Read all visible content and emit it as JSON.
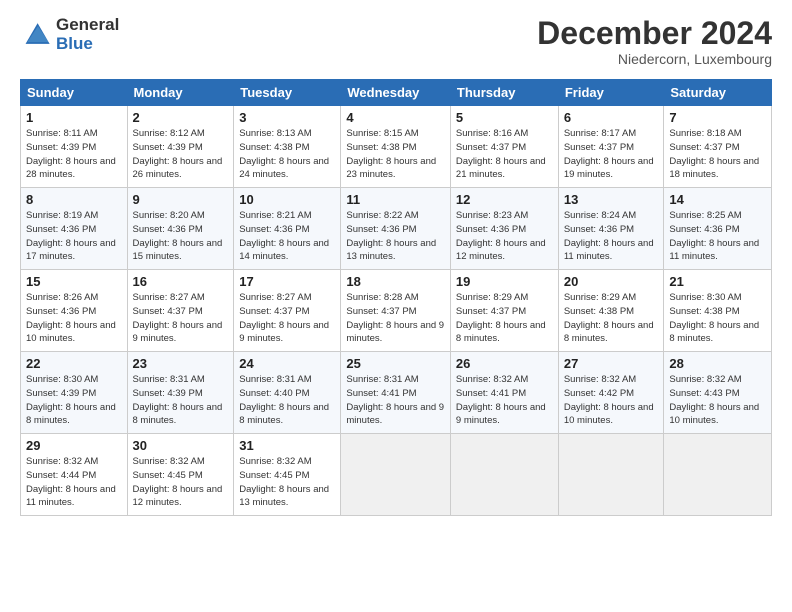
{
  "header": {
    "logo_general": "General",
    "logo_blue": "Blue",
    "month_title": "December 2024",
    "location": "Niedercorn, Luxembourg"
  },
  "weekdays": [
    "Sunday",
    "Monday",
    "Tuesday",
    "Wednesday",
    "Thursday",
    "Friday",
    "Saturday"
  ],
  "weeks": [
    [
      {
        "day": "1",
        "sunrise": "8:11 AM",
        "sunset": "4:39 PM",
        "daylight": "8 hours and 28 minutes."
      },
      {
        "day": "2",
        "sunrise": "8:12 AM",
        "sunset": "4:39 PM",
        "daylight": "8 hours and 26 minutes."
      },
      {
        "day": "3",
        "sunrise": "8:13 AM",
        "sunset": "4:38 PM",
        "daylight": "8 hours and 24 minutes."
      },
      {
        "day": "4",
        "sunrise": "8:15 AM",
        "sunset": "4:38 PM",
        "daylight": "8 hours and 23 minutes."
      },
      {
        "day": "5",
        "sunrise": "8:16 AM",
        "sunset": "4:37 PM",
        "daylight": "8 hours and 21 minutes."
      },
      {
        "day": "6",
        "sunrise": "8:17 AM",
        "sunset": "4:37 PM",
        "daylight": "8 hours and 19 minutes."
      },
      {
        "day": "7",
        "sunrise": "8:18 AM",
        "sunset": "4:37 PM",
        "daylight": "8 hours and 18 minutes."
      }
    ],
    [
      {
        "day": "8",
        "sunrise": "8:19 AM",
        "sunset": "4:36 PM",
        "daylight": "8 hours and 17 minutes."
      },
      {
        "day": "9",
        "sunrise": "8:20 AM",
        "sunset": "4:36 PM",
        "daylight": "8 hours and 15 minutes."
      },
      {
        "day": "10",
        "sunrise": "8:21 AM",
        "sunset": "4:36 PM",
        "daylight": "8 hours and 14 minutes."
      },
      {
        "day": "11",
        "sunrise": "8:22 AM",
        "sunset": "4:36 PM",
        "daylight": "8 hours and 13 minutes."
      },
      {
        "day": "12",
        "sunrise": "8:23 AM",
        "sunset": "4:36 PM",
        "daylight": "8 hours and 12 minutes."
      },
      {
        "day": "13",
        "sunrise": "8:24 AM",
        "sunset": "4:36 PM",
        "daylight": "8 hours and 11 minutes."
      },
      {
        "day": "14",
        "sunrise": "8:25 AM",
        "sunset": "4:36 PM",
        "daylight": "8 hours and 11 minutes."
      }
    ],
    [
      {
        "day": "15",
        "sunrise": "8:26 AM",
        "sunset": "4:36 PM",
        "daylight": "8 hours and 10 minutes."
      },
      {
        "day": "16",
        "sunrise": "8:27 AM",
        "sunset": "4:37 PM",
        "daylight": "8 hours and 9 minutes."
      },
      {
        "day": "17",
        "sunrise": "8:27 AM",
        "sunset": "4:37 PM",
        "daylight": "8 hours and 9 minutes."
      },
      {
        "day": "18",
        "sunrise": "8:28 AM",
        "sunset": "4:37 PM",
        "daylight": "8 hours and 9 minutes."
      },
      {
        "day": "19",
        "sunrise": "8:29 AM",
        "sunset": "4:37 PM",
        "daylight": "8 hours and 8 minutes."
      },
      {
        "day": "20",
        "sunrise": "8:29 AM",
        "sunset": "4:38 PM",
        "daylight": "8 hours and 8 minutes."
      },
      {
        "day": "21",
        "sunrise": "8:30 AM",
        "sunset": "4:38 PM",
        "daylight": "8 hours and 8 minutes."
      }
    ],
    [
      {
        "day": "22",
        "sunrise": "8:30 AM",
        "sunset": "4:39 PM",
        "daylight": "8 hours and 8 minutes."
      },
      {
        "day": "23",
        "sunrise": "8:31 AM",
        "sunset": "4:39 PM",
        "daylight": "8 hours and 8 minutes."
      },
      {
        "day": "24",
        "sunrise": "8:31 AM",
        "sunset": "4:40 PM",
        "daylight": "8 hours and 8 minutes."
      },
      {
        "day": "25",
        "sunrise": "8:31 AM",
        "sunset": "4:41 PM",
        "daylight": "8 hours and 9 minutes."
      },
      {
        "day": "26",
        "sunrise": "8:32 AM",
        "sunset": "4:41 PM",
        "daylight": "8 hours and 9 minutes."
      },
      {
        "day": "27",
        "sunrise": "8:32 AM",
        "sunset": "4:42 PM",
        "daylight": "8 hours and 10 minutes."
      },
      {
        "day": "28",
        "sunrise": "8:32 AM",
        "sunset": "4:43 PM",
        "daylight": "8 hours and 10 minutes."
      }
    ],
    [
      {
        "day": "29",
        "sunrise": "8:32 AM",
        "sunset": "4:44 PM",
        "daylight": "8 hours and 11 minutes."
      },
      {
        "day": "30",
        "sunrise": "8:32 AM",
        "sunset": "4:45 PM",
        "daylight": "8 hours and 12 minutes."
      },
      {
        "day": "31",
        "sunrise": "8:32 AM",
        "sunset": "4:45 PM",
        "daylight": "8 hours and 13 minutes."
      },
      null,
      null,
      null,
      null
    ]
  ]
}
